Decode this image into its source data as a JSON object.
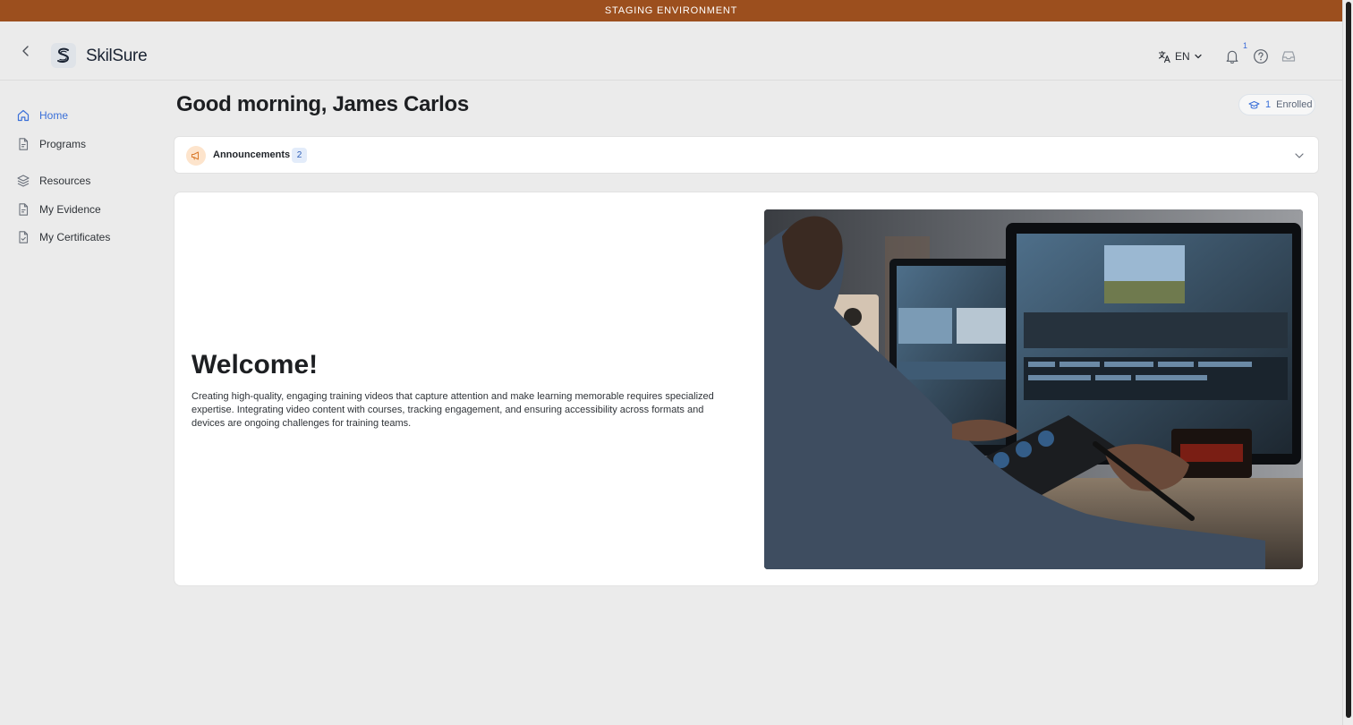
{
  "staging_banner": "STAGING ENVIRONMENT",
  "app": {
    "name": "SkilSure"
  },
  "header": {
    "language": "EN",
    "notification_count": "1"
  },
  "sidebar": {
    "items": [
      {
        "label": "Home",
        "icon": "home-icon",
        "active": true
      },
      {
        "label": "Programs",
        "icon": "document-icon"
      },
      {
        "label": "Resources",
        "icon": "layers-icon"
      },
      {
        "label": "My Evidence",
        "icon": "document-icon"
      },
      {
        "label": "My Certificates",
        "icon": "certificate-icon"
      }
    ]
  },
  "main": {
    "greeting": "Good morning, James Carlos",
    "enrolled": {
      "count": "1",
      "label": "Enrolled"
    },
    "announcements": {
      "title": "Announcements",
      "count": "2"
    },
    "welcome": {
      "title": "Welcome!",
      "body": "Creating high-quality, engaging training videos that capture attention and make learning memorable requires specialized expertise. Integrating video content with courses, tracking engagement, and ensuring accessibility across formats and devices are ongoing challenges for training teams."
    }
  },
  "colors": {
    "staging_bar": "#9c4f1e",
    "accent": "#3a6fd8",
    "background": "#ebebeb"
  }
}
